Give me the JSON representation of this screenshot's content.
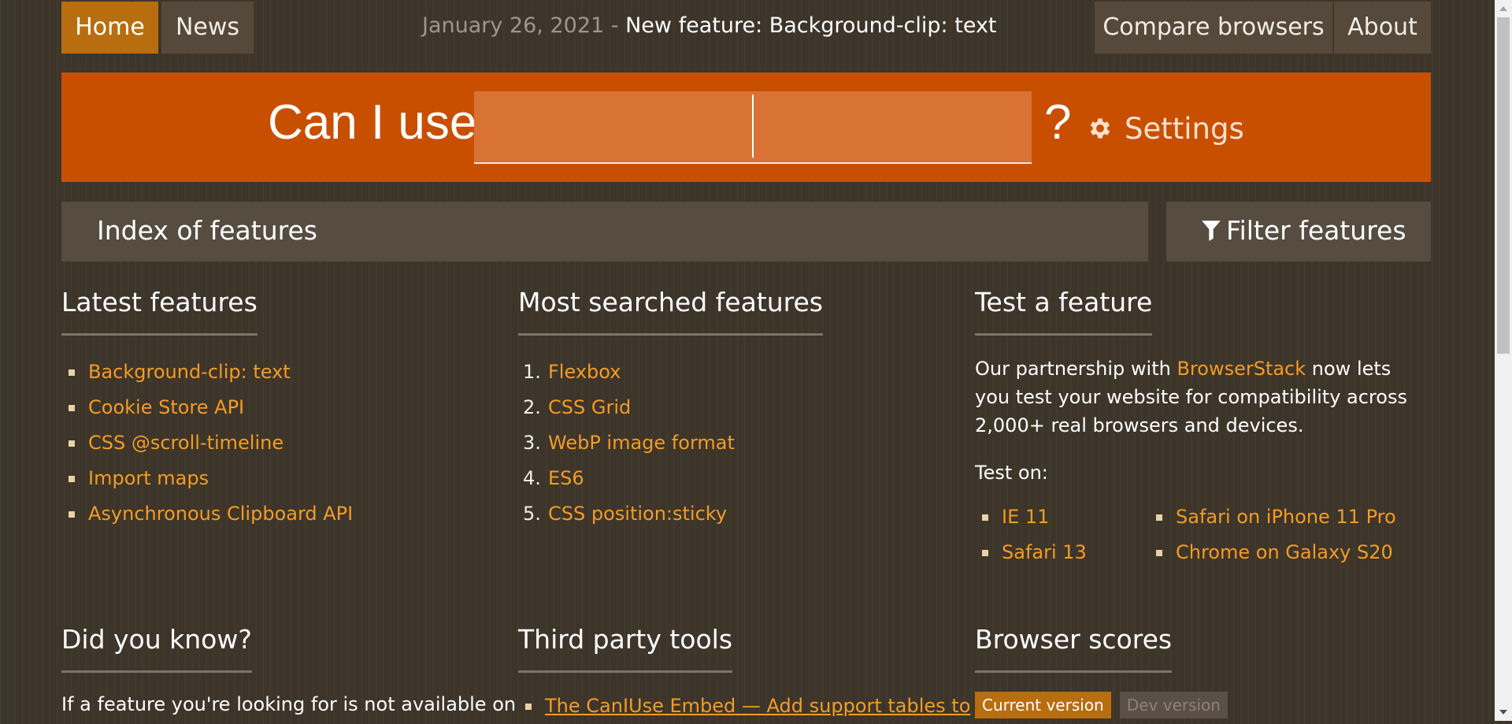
{
  "nav": {
    "home": "Home",
    "news": "News",
    "compare": "Compare browsers",
    "about": "About"
  },
  "newsline": {
    "date": "January 26, 2021",
    "separator": " - ",
    "title": "New feature: Background-clip: text"
  },
  "hero": {
    "label": "Can I use",
    "search_value": "",
    "qmark": "?",
    "settings": "Settings"
  },
  "index": {
    "title": "Index of features",
    "filter": "Filter features"
  },
  "latest": {
    "heading": "Latest features",
    "items": [
      "Background-clip: text",
      "Cookie Store API",
      "CSS @scroll-timeline",
      "Import maps",
      "Asynchronous Clipboard API"
    ]
  },
  "searched": {
    "heading": "Most searched features",
    "items": [
      {
        "num": "1.",
        "label": "Flexbox"
      },
      {
        "num": "2.",
        "label": "CSS Grid"
      },
      {
        "num": "3.",
        "label": "WebP image format"
      },
      {
        "num": "4.",
        "label": "ES6"
      },
      {
        "num": "5.",
        "label": "CSS position:sticky"
      }
    ]
  },
  "test": {
    "heading": "Test a feature",
    "intro_before": "Our partnership with ",
    "intro_link": "BrowserStack",
    "intro_after": " now lets you test your website for compatibility across 2,000+ real browsers and devices.",
    "test_on": "Test on:",
    "left": [
      "IE 11",
      "Safari 13"
    ],
    "right": [
      "Safari on iPhone 11 Pro",
      "Chrome on Galaxy S20"
    ]
  },
  "didyouknow": {
    "heading": "Did you know?",
    "text": "If a feature you're looking for is not available on"
  },
  "thirdparty": {
    "heading": "Third party tools",
    "item": "The CanIUse Embed — Add support tables to"
  },
  "scores": {
    "heading": "Browser scores",
    "current": "Current version",
    "dev": "Dev version"
  },
  "colors": {
    "accent": "#c94f00",
    "active_nav": "#b86d0f",
    "link": "#f39b27",
    "background": "#3d3529"
  }
}
